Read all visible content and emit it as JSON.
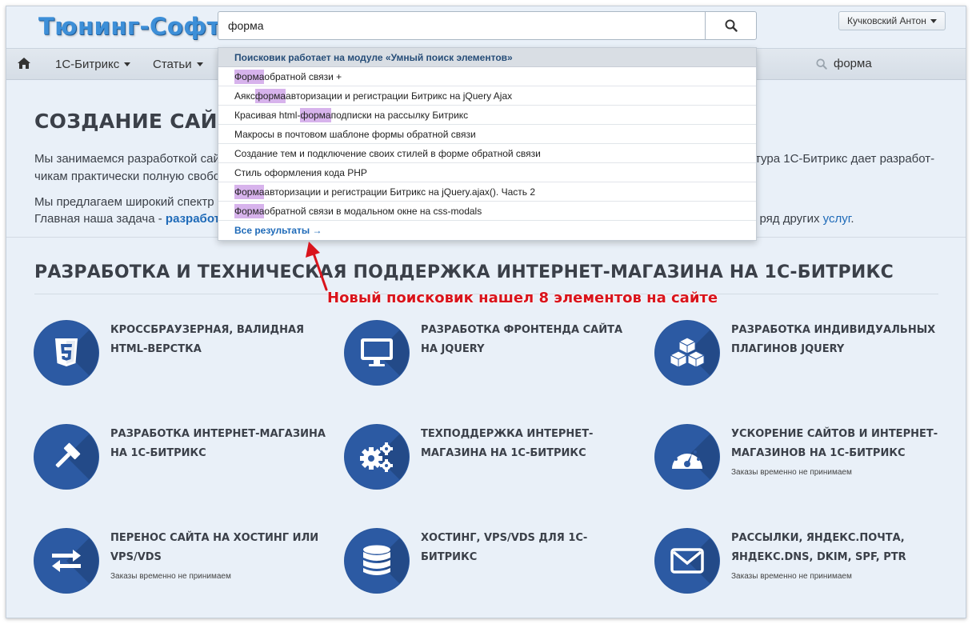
{
  "header": {
    "logo": "Тюнинг-Софт",
    "search": {
      "value": "форма",
      "icon": "search-icon"
    },
    "user": {
      "name": "Кучковский Антон"
    }
  },
  "nav": {
    "home_icon": "home-icon",
    "items": [
      {
        "label": "1С-Битрикс"
      },
      {
        "label": "Статьи"
      }
    ],
    "search_text": "форма"
  },
  "dropdown": {
    "header": "Поисковик работает на модуле «Умный поиск элементов»",
    "items": [
      {
        "hl": "Форма",
        "before": "",
        "after": " обратной связи +"
      },
      {
        "hl": "форма",
        "before": "Аякс ",
        "after": " авторизации и регистрации Битрикс на jQuery Ajax"
      },
      {
        "hl": "форма",
        "before": "Красивая html-",
        "after": " подписки на рассылку Битрикс"
      },
      {
        "hl": "",
        "before": "Макросы в почтовом шаблоне формы обратной связи",
        "after": ""
      },
      {
        "hl": "",
        "before": "Создание тем и подключение своих стилей в форме обратной связи",
        "after": ""
      },
      {
        "hl": "",
        "before": "Стиль оформления кода PHP",
        "after": ""
      },
      {
        "hl": "Форма",
        "before": "",
        "after": " авторизации и регистрации Битрикс на jQuery.ajax(). Часть 2"
      },
      {
        "hl": "Форма",
        "before": "",
        "after": " обратной связи в модальном окне на css-modals"
      }
    ],
    "all_results": "Все результаты →"
  },
  "main": {
    "title": "СОЗДАНИЕ САЙТО",
    "p1_left": "Мы занимаемся разработкой сайт",
    "p1_right": "тура 1С-Битрикс дает разработ-",
    "p2_left": "чикам практически полную свобод",
    "p3_left": "Мы предлагаем широкий спектр у",
    "p4_left": "Главная наша задача - ",
    "p4_link": "разработ",
    "p4_right": "е ряд других ",
    "p4_right_link": "услуг",
    "p4_end": ".",
    "section_title": "РАЗРАБОТКА И ТЕХНИЧЕСКАЯ ПОДДЕРЖКА ИНТЕРНЕТ-МАГАЗИНА НА 1С-БИТРИКС"
  },
  "annotation": "Новый поисковик нашел 8 элементов на сайте",
  "services": [
    {
      "title": "КРОССБРАУЗЕРНАЯ, ВАЛИДНАЯ HTML-ВЕРСТКА",
      "note": "",
      "icon": "html5-icon"
    },
    {
      "title": "РАЗРАБОТКА ФРОНТЕНДА САЙТА НА JQUERY",
      "note": "",
      "icon": "monitor-icon"
    },
    {
      "title": "РАЗРАБОТКА ИНДИВИДУАЛЬНЫХ ПЛАГИНОВ JQUERY",
      "note": "",
      "icon": "cubes-icon"
    },
    {
      "title": "РАЗРАБОТКА ИНТЕРНЕТ-МАГАЗИНА НА 1С-БИТРИКС",
      "note": "",
      "icon": "gavel-icon"
    },
    {
      "title": "ТЕХПОДДЕРЖКА ИНТЕРНЕТ-МАГАЗИНА НА 1С-БИТРИКС",
      "note": "",
      "icon": "gears-icon"
    },
    {
      "title": "УСКОРЕНИЕ САЙТОВ И ИНТЕРНЕТ-МАГАЗИНОВ НА 1С-БИТРИКС",
      "note": "Заказы временно не принимаем",
      "icon": "speedometer-icon"
    },
    {
      "title": "ПЕРЕНОС САЙТА НА ХОСТИНГ ИЛИ VPS/VDS",
      "note": "Заказы временно не принимаем",
      "icon": "transfer-icon"
    },
    {
      "title": "ХОСТИНГ, VPS/VDS ДЛЯ 1С-БИТРИКС",
      "note": "",
      "icon": "database-icon"
    },
    {
      "title": "РАССЫЛКИ, ЯНДЕКС.ПОЧТА, ЯНДЕКС.DNS, DKIM, SPF, PTR",
      "note": "Заказы временно не принимаем",
      "icon": "envelope-icon"
    }
  ],
  "colors": {
    "accent": "#2c5aa3",
    "link": "#1e6ab8",
    "highlight": "#d7b3ec",
    "annotation": "#d9141c"
  }
}
